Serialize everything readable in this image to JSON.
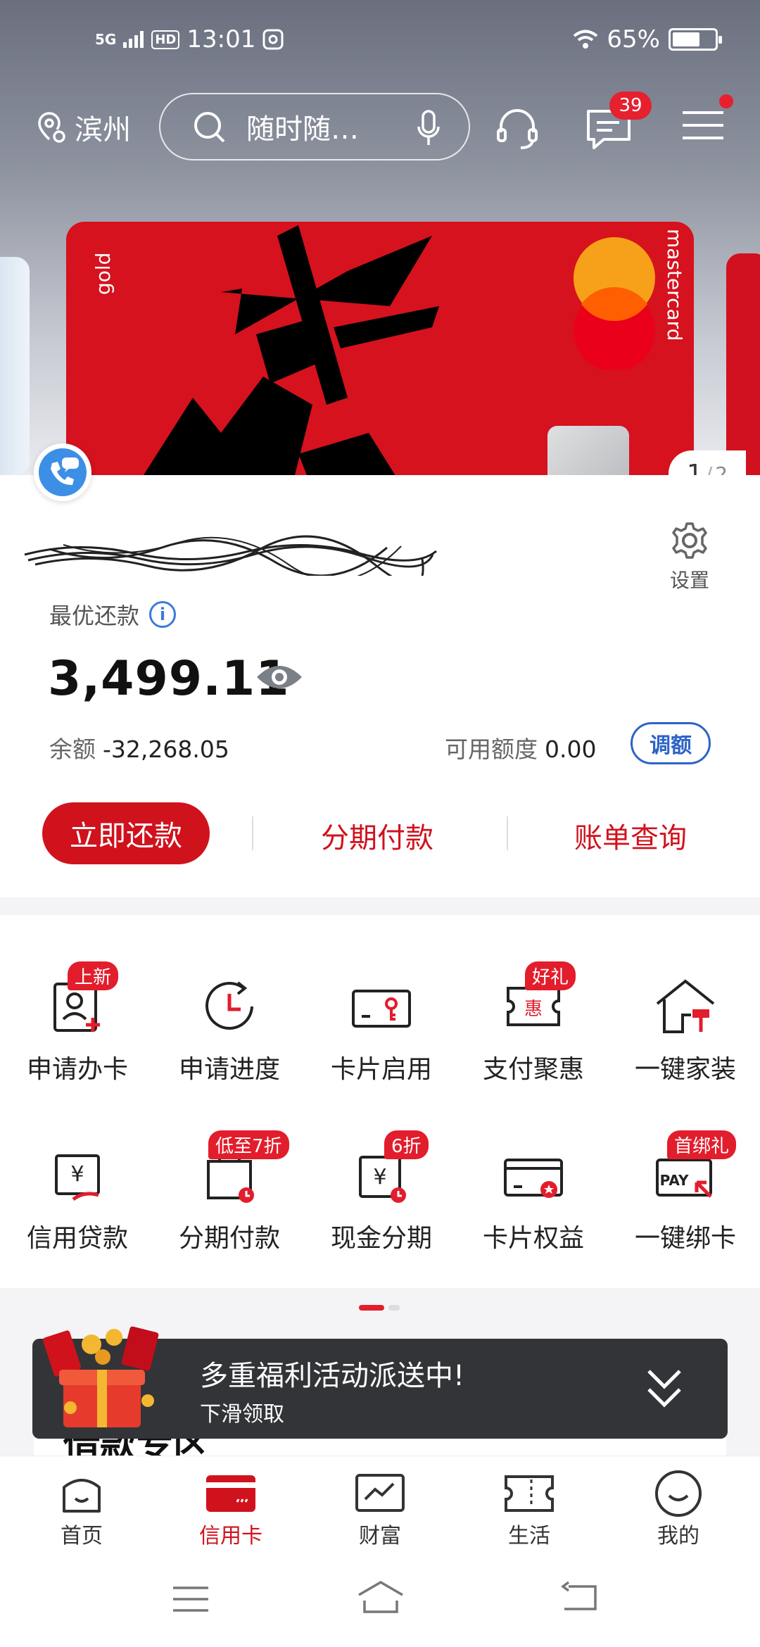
{
  "status_bar": {
    "network": "5G",
    "hd": "HD",
    "time": "13:01",
    "battery": "65%",
    "battery_level": 0.65
  },
  "header": {
    "city": "滨州",
    "search_placeholder": "随时随…",
    "message_badge": "39"
  },
  "card": {
    "tier_text": "gold",
    "network_text": "mastercard",
    "pager_current": "1",
    "pager_total": "2"
  },
  "account": {
    "settings_label": "设置",
    "best_repay_label": "最优还款",
    "best_repay_amount": "3,499.11",
    "balance_label": "余额",
    "balance_value": "-32,268.05",
    "available_label": "可用额度",
    "available_value": "0.00",
    "adjust_label": "调额",
    "actions": {
      "repay_now": "立即还款",
      "installment": "分期付款",
      "bill_query": "账单查询"
    }
  },
  "services": [
    {
      "label": "申请办卡",
      "tag": "上新",
      "icon": "apply-card-icon"
    },
    {
      "label": "申请进度",
      "tag": "",
      "icon": "progress-icon"
    },
    {
      "label": "卡片启用",
      "tag": "",
      "icon": "card-activate-icon"
    },
    {
      "label": "支付聚惠",
      "tag": "好礼",
      "icon": "pay-discount-icon"
    },
    {
      "label": "一键家装",
      "tag": "",
      "icon": "home-decor-icon"
    },
    {
      "label": "信用贷款",
      "tag": "",
      "icon": "credit-loan-icon"
    },
    {
      "label": "分期付款",
      "tag": "低至7折",
      "icon": "installment-icon"
    },
    {
      "label": "现金分期",
      "tag": "6折",
      "icon": "cash-installment-icon"
    },
    {
      "label": "卡片权益",
      "tag": "",
      "icon": "card-benefits-icon"
    },
    {
      "label": "一键绑卡",
      "tag": "首绑礼",
      "icon": "bind-card-icon"
    }
  ],
  "promo": {
    "title": "多重福利活动派送中!",
    "subtitle": "下滑领取",
    "section_title": "借款专区"
  },
  "tabs": [
    {
      "label": "首页",
      "icon": "home-icon"
    },
    {
      "label": "信用卡",
      "icon": "credit-card-icon"
    },
    {
      "label": "财富",
      "icon": "wealth-icon"
    },
    {
      "label": "生活",
      "icon": "life-ticket-icon"
    },
    {
      "label": "我的",
      "icon": "profile-icon"
    }
  ],
  "colors": {
    "brand_red": "#d0121d",
    "link_blue": "#2d64c6",
    "badge_red": "#e21d2c"
  }
}
